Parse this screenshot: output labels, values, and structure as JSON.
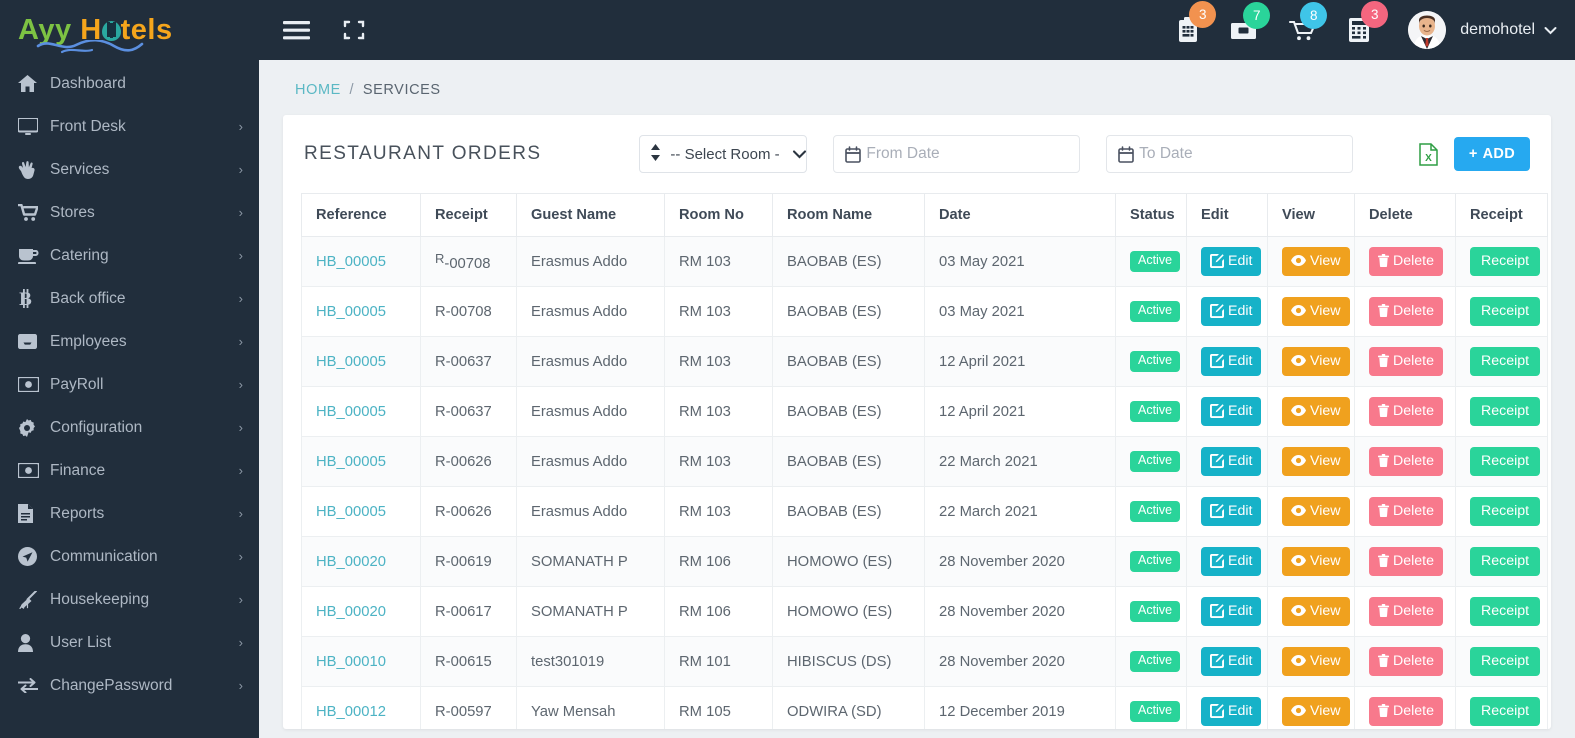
{
  "brand": {
    "part1": "Ayy",
    "part2_h": "H",
    "part2_rest": "tels"
  },
  "sidebar": {
    "items": [
      {
        "label": "Dashboard",
        "icon": "home-icon",
        "arrow": false
      },
      {
        "label": "Front Desk",
        "icon": "monitor-icon",
        "arrow": true
      },
      {
        "label": "Services",
        "icon": "hand-icon",
        "arrow": true
      },
      {
        "label": "Stores",
        "icon": "cart-icon",
        "arrow": true
      },
      {
        "label": "Catering",
        "icon": "coffee-cup-icon",
        "arrow": true
      },
      {
        "label": "Back office",
        "icon": "bitcoin-icon",
        "arrow": true
      },
      {
        "label": "Employees",
        "icon": "inbox-icon",
        "arrow": true
      },
      {
        "label": "PayRoll",
        "icon": "money-icon",
        "arrow": true
      },
      {
        "label": "Configuration",
        "icon": "gear-icon",
        "arrow": true
      },
      {
        "label": "Finance",
        "icon": "money-icon",
        "arrow": true
      },
      {
        "label": "Reports",
        "icon": "document-icon",
        "arrow": true
      },
      {
        "label": "Communication",
        "icon": "paper-plane-icon",
        "arrow": true
      },
      {
        "label": "Housekeeping",
        "icon": "broom-icon",
        "arrow": true
      },
      {
        "label": "User List",
        "icon": "user-icon",
        "arrow": true
      },
      {
        "label": "ChangePassword",
        "icon": "exchange-icon",
        "arrow": true
      }
    ],
    "arrow_glyph": "›"
  },
  "topbar": {
    "hamburger": "menu-icon",
    "fullscreen": "expand-icon",
    "notifications": [
      {
        "icon": "clipboard-icon",
        "count": "3",
        "color": "#f2924f"
      },
      {
        "icon": "archive-icon",
        "count": "7",
        "color": "#2ad49a"
      },
      {
        "icon": "cart-icon",
        "count": "8",
        "color": "#3fc5e8"
      },
      {
        "icon": "calculator-icon",
        "count": "3",
        "color": "#f4667f"
      }
    ],
    "user_name": "demohotel",
    "caret": "⌄"
  },
  "breadcrumb": {
    "home": "HOME",
    "separator": "/",
    "current": "SERVICES"
  },
  "card": {
    "title": "RESTAURANT ORDERS",
    "room_select": {
      "value": "-- Select Room -",
      "caret": "⌄"
    },
    "from_date": {
      "placeholder": "From Date",
      "value": ""
    },
    "to_date": {
      "placeholder": "To Date",
      "value": ""
    },
    "excel_export": "excel-export-icon",
    "add_button": "ADD",
    "add_plus": "+"
  },
  "table": {
    "columns": [
      "Reference",
      "Receipt",
      "Guest Name",
      "Room No",
      "Room Name",
      "Date",
      "Status",
      "Edit",
      "View",
      "Delete",
      "Receipt"
    ],
    "action_labels": {
      "status": "Active",
      "edit": "Edit",
      "view": "View",
      "delete": "Delete",
      "receipt": "Receipt"
    },
    "rows": [
      {
        "reference": "HB_00005",
        "receipt": "R-00708",
        "guest": "Erasmus Addo",
        "room_no": "RM 103",
        "room_name": "BAOBAB (ES)",
        "date": "03 May 2021",
        "status": "Active",
        "raised_r": true
      },
      {
        "reference": "HB_00005",
        "receipt": "R-00708",
        "guest": "Erasmus Addo",
        "room_no": "RM 103",
        "room_name": "BAOBAB (ES)",
        "date": "03 May 2021",
        "status": "Active"
      },
      {
        "reference": "HB_00005",
        "receipt": "R-00637",
        "guest": "Erasmus Addo",
        "room_no": "RM 103",
        "room_name": "BAOBAB (ES)",
        "date": "12 April 2021",
        "status": "Active"
      },
      {
        "reference": "HB_00005",
        "receipt": "R-00637",
        "guest": "Erasmus Addo",
        "room_no": "RM 103",
        "room_name": "BAOBAB (ES)",
        "date": "12 April 2021",
        "status": "Active"
      },
      {
        "reference": "HB_00005",
        "receipt": "R-00626",
        "guest": "Erasmus Addo",
        "room_no": "RM 103",
        "room_name": "BAOBAB (ES)",
        "date": "22 March 2021",
        "status": "Active"
      },
      {
        "reference": "HB_00005",
        "receipt": "R-00626",
        "guest": "Erasmus Addo",
        "room_no": "RM 103",
        "room_name": "BAOBAB (ES)",
        "date": "22 March 2021",
        "status": "Active"
      },
      {
        "reference": "HB_00020",
        "receipt": "R-00619",
        "guest": "SOMANATH P",
        "room_no": "RM 106",
        "room_name": "HOMOWO (ES)",
        "date": "28 November 2020",
        "status": "Active"
      },
      {
        "reference": "HB_00020",
        "receipt": "R-00617",
        "guest": "SOMANATH P",
        "room_no": "RM 106",
        "room_name": "HOMOWO (ES)",
        "date": "28 November 2020",
        "status": "Active"
      },
      {
        "reference": "HB_00010",
        "receipt": "R-00615",
        "guest": "test301019",
        "room_no": "RM 101",
        "room_name": "HIBISCUS (DS)",
        "date": "28 November 2020",
        "status": "Active"
      },
      {
        "reference": "HB_00012",
        "receipt": "R-00597",
        "guest": "Yaw Mensah",
        "room_no": "RM 105",
        "room_name": "ODWIRA (SD)",
        "date": "12 December 2019",
        "status": "Active"
      }
    ]
  }
}
